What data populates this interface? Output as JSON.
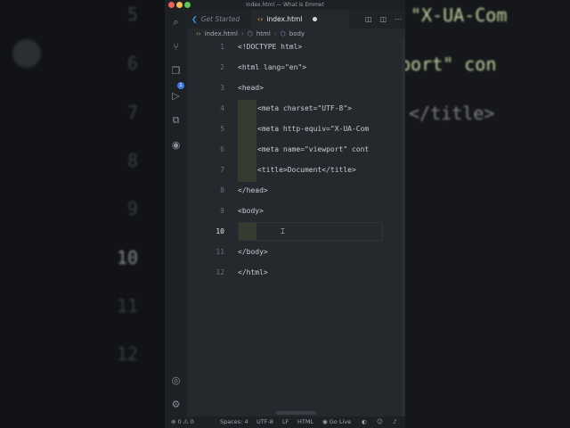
{
  "window": {
    "title": "index.html — What is Emmet"
  },
  "tabs": [
    {
      "label": "Get Started",
      "active": false,
      "icon": "vscode-logo-icon"
    },
    {
      "label": "index.html",
      "active": true,
      "modified": true,
      "icon": "html-file-icon"
    }
  ],
  "breadcrumbs": [
    "index.html",
    "html",
    "body"
  ],
  "activity_bar": {
    "icons": [
      "search-icon",
      "source-control-icon",
      "explorer-icon",
      "run-debug-icon",
      "extensions-icon",
      "github-icon",
      "account-icon",
      "settings-gear-icon"
    ],
    "badge": "1"
  },
  "editor": {
    "lines": [
      {
        "n": "1",
        "text": "<!DOCTYPE html>"
      },
      {
        "n": "2",
        "text": "<html lang=\"en\">"
      },
      {
        "n": "3",
        "text": "<head>"
      },
      {
        "n": "4",
        "text": "<meta charset=\"UTF-8\">"
      },
      {
        "n": "5",
        "text": "<meta http-equiv=\"X-UA-Com"
      },
      {
        "n": "6",
        "text": "<meta name=\"viewport\" cont"
      },
      {
        "n": "7",
        "text": "<title>Document</title>"
      },
      {
        "n": "8",
        "text": "</head>"
      },
      {
        "n": "9",
        "text": "<body>"
      },
      {
        "n": "10",
        "text": ""
      },
      {
        "n": "11",
        "text": "</body>"
      },
      {
        "n": "12",
        "text": "</html>"
      }
    ],
    "active_line": "10"
  },
  "status_bar": {
    "errors": "0",
    "warnings": "0",
    "spaces": "Spaces: 4",
    "encoding": "UTF-8",
    "eol": "LF",
    "language": "HTML",
    "go_live": "Go Live"
  },
  "background": {
    "left_numbers": [
      "5",
      "6",
      "7",
      "8",
      "9",
      "10",
      "11",
      "12"
    ],
    "right_code": [
      "\"X-UA-Com",
      "port\" con",
      "</title>"
    ]
  },
  "colors": {
    "editor_bg": "#25292e",
    "accent_blue": "#3c7be0",
    "html_icon": "#f0a050"
  }
}
